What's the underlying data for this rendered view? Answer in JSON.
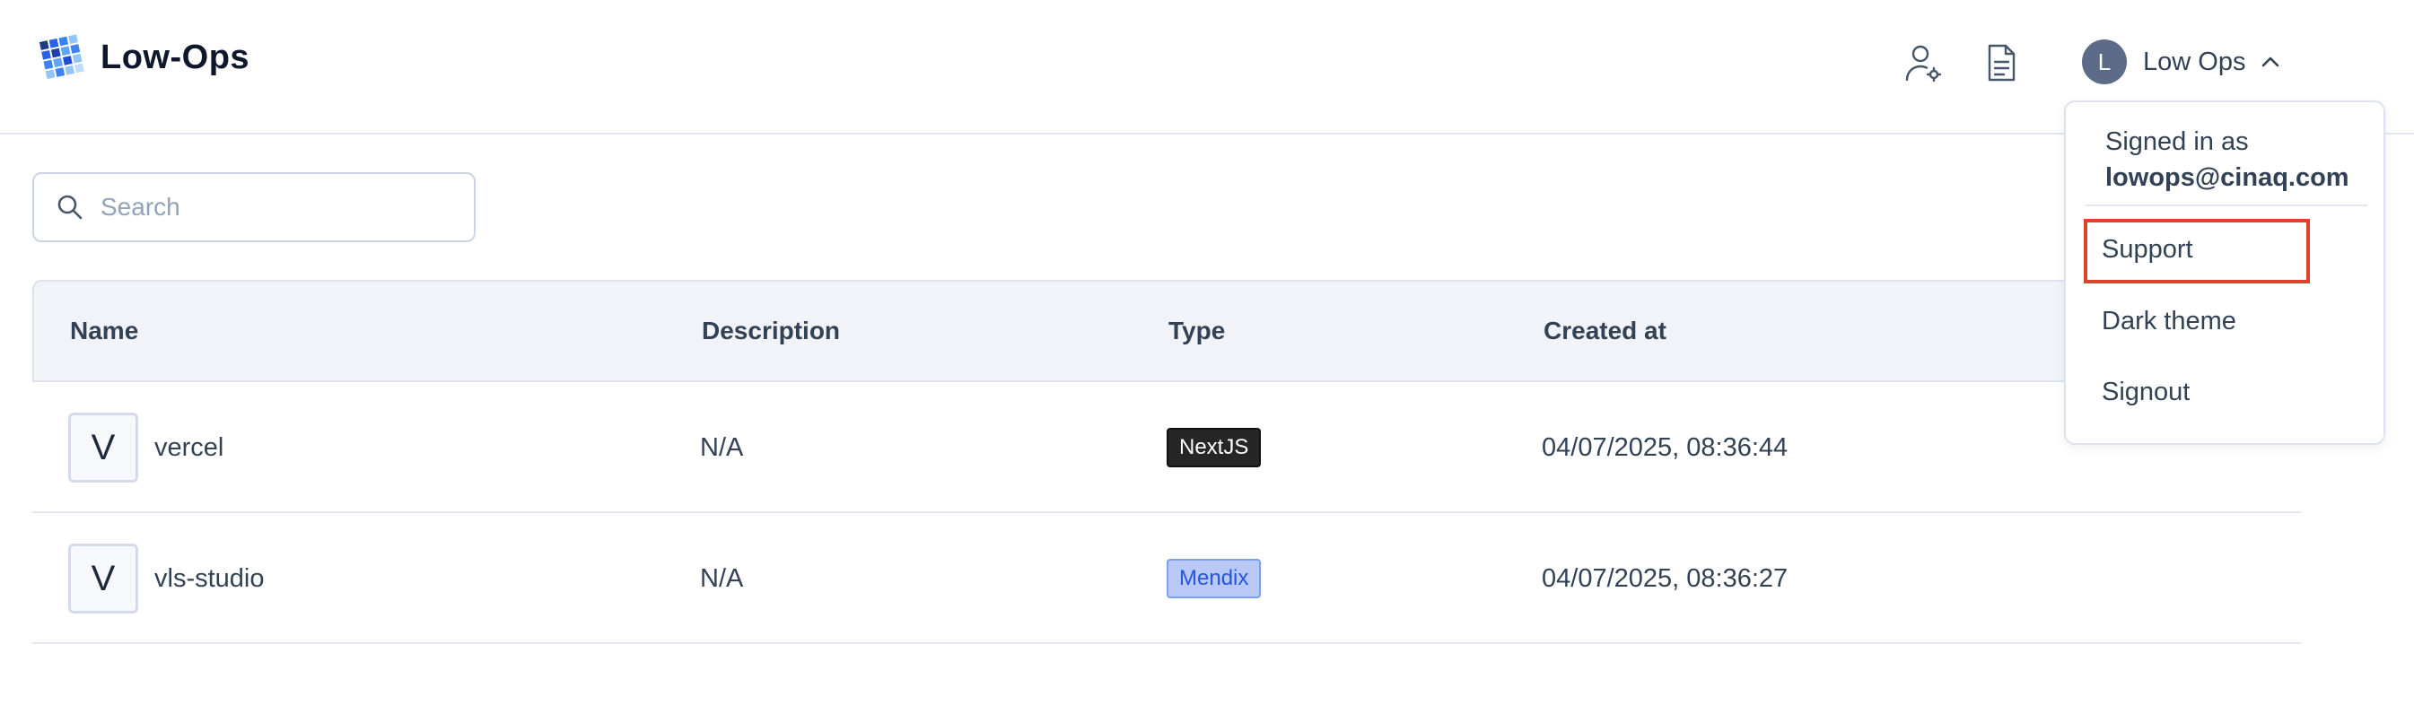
{
  "app": {
    "name": "Low-Ops"
  },
  "header": {
    "icons": [
      "user-settings-icon",
      "document-icon"
    ],
    "user": {
      "initial": "L",
      "name": "Low Ops"
    }
  },
  "search": {
    "placeholder": "Search",
    "value": ""
  },
  "table": {
    "columns": [
      "Name",
      "Description",
      "Type",
      "Created at"
    ],
    "rows": [
      {
        "avatar": "V",
        "name": "vercel",
        "description": "N/A",
        "type": "NextJS",
        "created_at": "04/07/2025, 08:36:44"
      },
      {
        "avatar": "V",
        "name": "vls-studio",
        "description": "N/A",
        "type": "Mendix",
        "created_at": "04/07/2025, 08:36:27"
      }
    ]
  },
  "dropdown": {
    "signed_in_label": "Signed in as",
    "email": "lowops@cinaq.com",
    "items": [
      "Support",
      "Dark theme",
      "Signout"
    ]
  },
  "colors": {
    "accent": "#5b6b88",
    "highlight": "#e0412b",
    "nextjs_badge": "#262626",
    "mendix_badge": "#b8c8f7"
  }
}
